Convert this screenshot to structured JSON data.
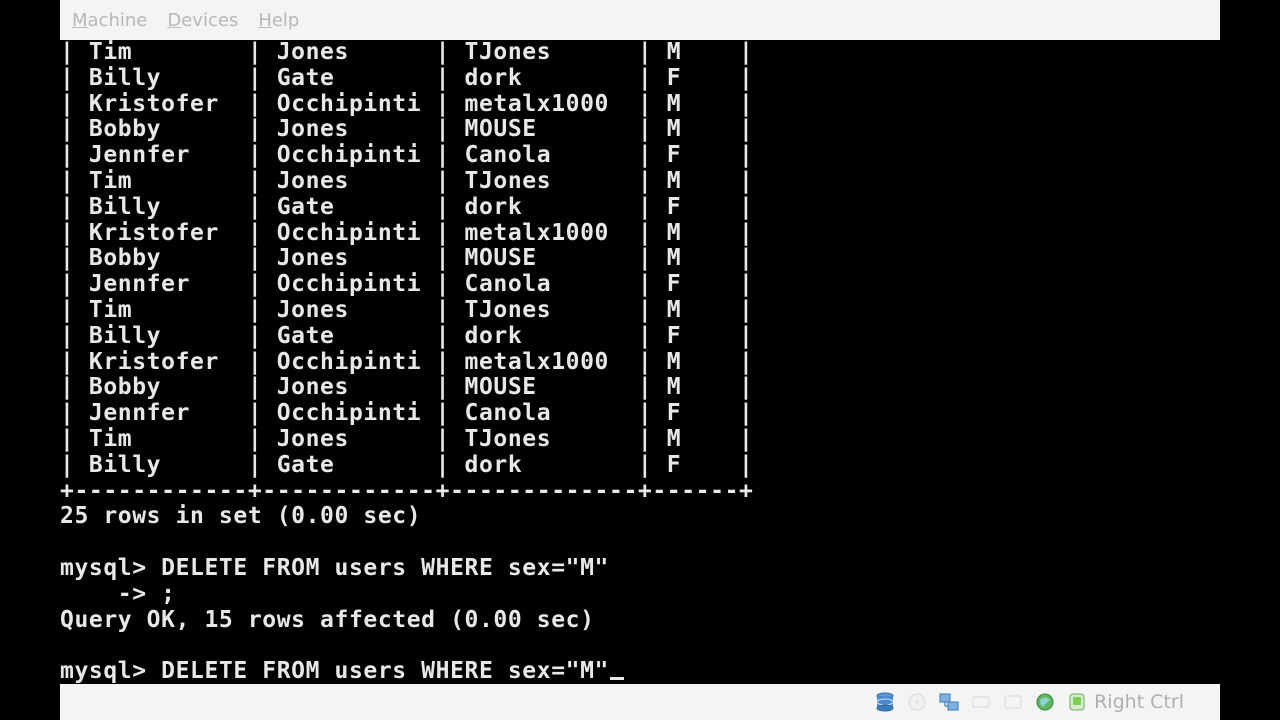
{
  "menubar": {
    "items": [
      {
        "label": "Machine"
      },
      {
        "label": "Devices"
      },
      {
        "label": "Help"
      }
    ]
  },
  "terminal": {
    "lines": [
      "| Tim        | Jones      | TJones      | M    |",
      "| Billy      | Gate       | dork        | F    |",
      "| Kristofer  | Occhipinti | metalx1000  | M    |",
      "| Bobby      | Jones      | MOUSE       | M    |",
      "| Jennfer    | Occhipinti | Canola      | F    |",
      "| Tim        | Jones      | TJones      | M    |",
      "| Billy      | Gate       | dork        | F    |",
      "| Kristofer  | Occhipinti | metalx1000  | M    |",
      "| Bobby      | Jones      | MOUSE       | M    |",
      "| Jennfer    | Occhipinti | Canola      | F    |",
      "| Tim        | Jones      | TJones      | M    |",
      "| Billy      | Gate       | dork        | F    |",
      "| Kristofer  | Occhipinti | metalx1000  | M    |",
      "| Bobby      | Jones      | MOUSE       | M    |",
      "| Jennfer    | Occhipinti | Canola      | F    |",
      "| Tim        | Jones      | TJones      | M    |",
      "| Billy      | Gate       | dork        | F    |",
      "+------------+------------+-------------+------+",
      "25 rows in set (0.00 sec)",
      "",
      "mysql> DELETE FROM users WHERE sex=\"M\"",
      "    -> ;",
      "Query OK, 15 rows affected (0.00 sec)",
      "",
      "mysql> DELETE FROM users WHERE sex=\"M\""
    ]
  },
  "statusbar": {
    "icons": [
      "hard-disk-icon",
      "optical-drive-icon",
      "network-icon",
      "usb-icon",
      "shared-folder-icon",
      "virtualization-icon",
      "mouse-integration-icon"
    ],
    "host_key": "Right Ctrl"
  }
}
